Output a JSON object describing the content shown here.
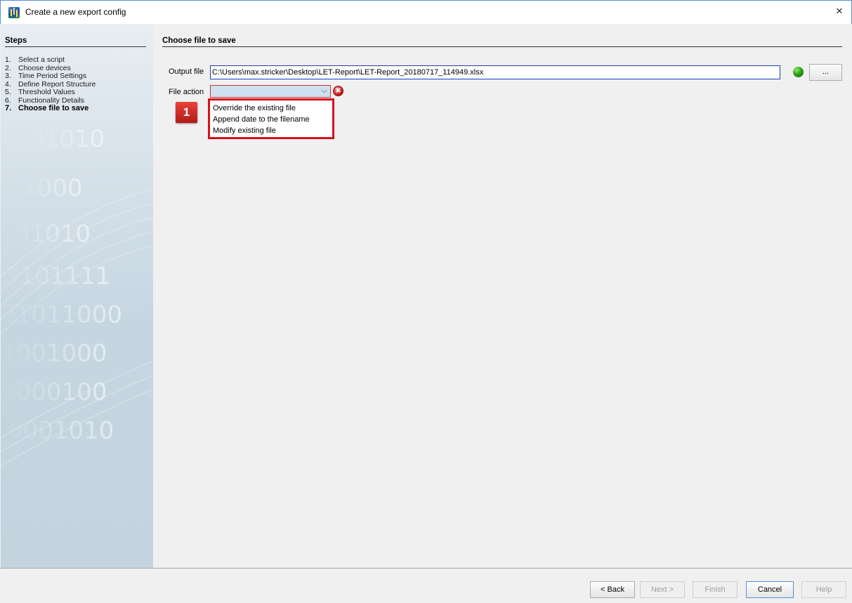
{
  "window": {
    "title": "Create a new export config",
    "close_glyph": "×"
  },
  "sidebar": {
    "heading": "Steps",
    "steps": [
      {
        "num": "1.",
        "label": "Select a script"
      },
      {
        "num": "2.",
        "label": "Choose devices"
      },
      {
        "num": "3.",
        "label": "Time Period Settings"
      },
      {
        "num": "4.",
        "label": "Define Report Structure"
      },
      {
        "num": "5.",
        "label": "Threshold Values"
      },
      {
        "num": "6.",
        "label": "Functionality Details"
      },
      {
        "num": "7.",
        "label": "Choose file to save"
      }
    ],
    "active_step": 6
  },
  "main": {
    "heading": "Choose file to save",
    "output_file": {
      "label": "Output file",
      "value": "C:\\Users\\max.stricker\\Desktop\\LET-Report\\LET-Report_20180717_114949.xlsx",
      "status_color": "#2fa318",
      "browse_label": "..."
    },
    "file_action": {
      "label": "File action",
      "value": "",
      "caret": "⌵",
      "error_glyph": "✖",
      "options": [
        "Override the existing file",
        "Append date to the filename",
        "Modify existing file"
      ]
    },
    "callout_badge": "1"
  },
  "footer": {
    "back": "< Back",
    "next": "Next >",
    "finish": "Finish",
    "cancel": "Cancel",
    "help": "Help"
  },
  "colors": {
    "accent": "#1a3fb5",
    "highlight": "#d8101c",
    "sidebar": "#c6d6e1"
  }
}
